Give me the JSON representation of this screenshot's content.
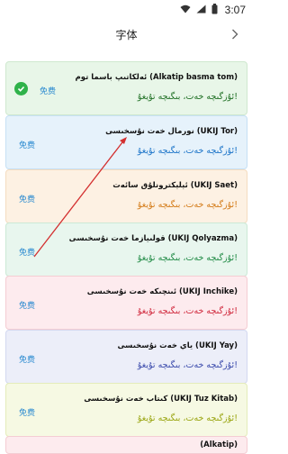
{
  "status": {
    "time": "3:07"
  },
  "header": {
    "title": "字体"
  },
  "fonts": [
    {
      "name": "ئەلكاتىپ باسما توم (Alkatip basma tom)",
      "sample": "ئۇزگىچە خەت، بىگىچە تۇيغۇ!",
      "free": "免费",
      "bg": "#e8f6e8",
      "border": "#cfe8cf",
      "sample_color": "#1e6f23",
      "selected": true
    },
    {
      "name": "نورمال خەت نۇسخىسى (UKIJ Tor)",
      "sample": "ئۇزگىچە خەت، بىگىچە تۇيغۇ!",
      "free": "免费",
      "bg": "#e6f2fb",
      "border": "#c6e0f4",
      "sample_color": "#1a73c8",
      "selected": false
    },
    {
      "name": "ئېلېكترونلۇق سائەت (UKIJ Saet)",
      "sample": "ئۇزگىچە خەت، بىگىچە تۇيغۇ!",
      "free": "免费",
      "bg": "#fdf1e3",
      "border": "#f4dcc0",
      "sample_color": "#d37a16",
      "selected": false
    },
    {
      "name": "قولىيازما خەت نۇسخىسى (UKIJ Qolyazma)",
      "sample": "ئۇزگىچە خەت، بىگىچە تۇيغۇ!",
      "free": "免费",
      "bg": "#e8f6ee",
      "border": "#cbe9d6",
      "sample_color": "#1f8a44",
      "selected": false
    },
    {
      "name": "ئىنچىكە خەت نۇسخىسى (UKIJ Inchike)",
      "sample": "ئۇزگىچە خەت، بىگىچە تۇيغۇ!",
      "free": "免费",
      "bg": "#fdebee",
      "border": "#f4cdd3",
      "sample_color": "#d0273b",
      "selected": false
    },
    {
      "name": "ياي خەت نۇسخىسى (UKIJ Yay)",
      "sample": "ئۇزگىچە خەت، بىگىچە تۇيغۇ!",
      "free": "免费",
      "bg": "#eceef9",
      "border": "#d3d8f0",
      "sample_color": "#3949ab",
      "selected": false
    },
    {
      "name": "كىتاب خەت نۇسخىسى (UKIJ Tuz Kitab)",
      "sample": "ئۇزگىچە خەت، بىگىچە تۇيغۇ!",
      "free": "免费",
      "bg": "#f6f9e3",
      "border": "#e4ecba",
      "sample_color": "#9aa511",
      "selected": false
    },
    {
      "name": "(Alkatip)",
      "sample": "",
      "free": "",
      "bg": "#fdebee",
      "border": "#f4cdd3",
      "sample_color": "#d0273b",
      "selected": false
    }
  ],
  "colors": {
    "accent": "#2a8ad0",
    "check": "#2fb24a",
    "arrow": "#d32f2f"
  },
  "icons": {
    "wifi": "wifi-icon",
    "signal": "signal-icon",
    "battery": "battery-icon",
    "back": "chevron-right-icon",
    "check": "check-icon"
  }
}
